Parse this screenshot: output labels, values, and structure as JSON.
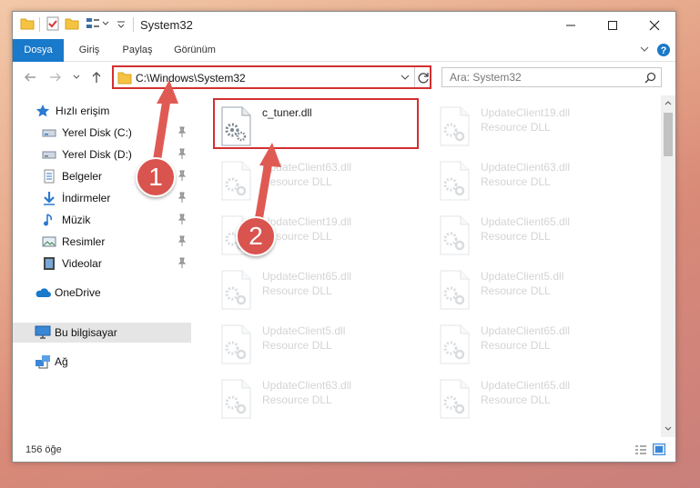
{
  "window": {
    "title": "System32",
    "ribbon_tabs": [
      "Dosya",
      "Giriş",
      "Paylaş",
      "Görünüm"
    ]
  },
  "navigation": {
    "address_path": "C:\\Windows\\System32",
    "search_placeholder": "Ara: System32"
  },
  "sidebar": {
    "items": [
      {
        "label": "Hızlı erişim",
        "icon": "star-icon"
      },
      {
        "label": "Yerel Disk (C:)",
        "icon": "drive-icon"
      },
      {
        "label": "Yerel Disk (D:)",
        "icon": "drive-icon"
      },
      {
        "label": "Belgeler",
        "icon": "documents-icon"
      },
      {
        "label": "İndirmeler",
        "icon": "download-icon"
      },
      {
        "label": "Müzik",
        "icon": "music-icon"
      },
      {
        "label": "Resimler",
        "icon": "pictures-icon"
      },
      {
        "label": "Videolar",
        "icon": "video-icon"
      },
      {
        "label": "OneDrive",
        "icon": "cloud-icon"
      },
      {
        "label": "Bu bilgisayar",
        "icon": "computer-icon"
      },
      {
        "label": "Ağ",
        "icon": "network-icon"
      }
    ]
  },
  "files": [
    {
      "name": "c_tuner.dll",
      "type": ""
    },
    {
      "name": "UpdateClient19.dll",
      "type": "Resource DLL"
    },
    {
      "name": "UpdateClient63.dll",
      "type": "Resource DLL"
    },
    {
      "name": "UpdateClient63.dll",
      "type": "Resource DLL"
    },
    {
      "name": "UpdateClient19.dll",
      "type": "Resource DLL"
    },
    {
      "name": "UpdateClient65.dll",
      "type": "Resource DLL"
    },
    {
      "name": "UpdateClient65.dll",
      "type": "Resource DLL"
    },
    {
      "name": "UpdateClient5.dll",
      "type": "Resource DLL"
    },
    {
      "name": "UpdateClient5.dll",
      "type": "Resource DLL"
    },
    {
      "name": "UpdateClient65.dll",
      "type": "Resource DLL"
    },
    {
      "name": "UpdateClient63.dll",
      "type": "Resource DLL"
    },
    {
      "name": "UpdateClient65.dll",
      "type": "Resource DLL"
    }
  ],
  "status": {
    "item_count": "156 öğe"
  },
  "callouts": [
    "1",
    "2"
  ],
  "colors": {
    "accent": "#1979ca",
    "highlight": "#d32f2f",
    "callout": "#d9534f"
  }
}
